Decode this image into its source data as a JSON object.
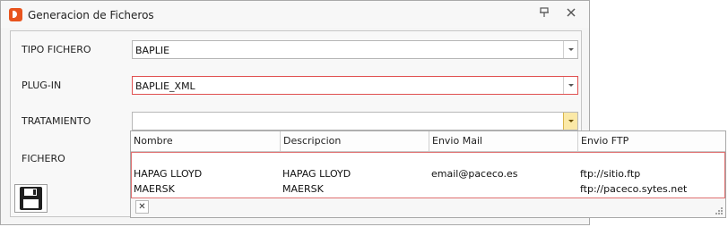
{
  "window": {
    "title": "Generacion de Ficheros"
  },
  "form": {
    "tipo_fichero": {
      "label": "TIPO FICHERO",
      "value": "BAPLIE"
    },
    "plugin": {
      "label": "PLUG-IN",
      "value": "BAPLIE_XML"
    },
    "tratamiento": {
      "label": "TRATAMIENTO",
      "value": ""
    },
    "fichero": {
      "label": "FICHERO"
    }
  },
  "dropdown": {
    "columns": [
      "Nombre",
      "Descripcion",
      "Envio Mail",
      "Envio FTP"
    ],
    "rows": [
      {
        "nombre": "HAPAG LLOYD",
        "descripcion": "HAPAG LLOYD",
        "mail": "email@paceco.es",
        "ftp": "ftp://sitio.ftp"
      },
      {
        "nombre": "MAERSK",
        "descripcion": "MAERSK",
        "mail": "",
        "ftp": "ftp://paceco.sytes.net"
      }
    ]
  },
  "icons": {
    "app": "app-logo-icon",
    "pin": "pin-icon",
    "close": "close-icon",
    "save": "floppy-disk-icon",
    "popup_close": "close-small-icon",
    "resize": "resize-grip-icon"
  },
  "colors": {
    "accent": "#e8541e",
    "invalid_border": "#e05050",
    "active_button": "#fbe9a7"
  }
}
